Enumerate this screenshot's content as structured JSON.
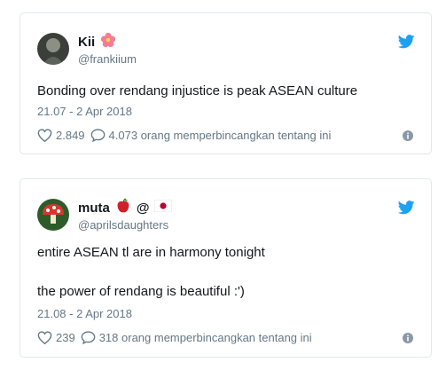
{
  "tweets": [
    {
      "name": "Kii",
      "handle": "@frankiium",
      "text_lines": [
        "Bonding over rendang injustice is peak ASEAN culture"
      ],
      "timestamp": "21.07 - 2 Apr 2018",
      "likes": "2.849",
      "replies_text": "4.073 orang memperbincangkan tentang ini"
    },
    {
      "name": "muta",
      "name_extra": "@",
      "handle": "@aprilsdaughters",
      "text_lines": [
        "entire ASEAN tl are in harmony tonight",
        "the power of rendang is beautiful :')"
      ],
      "timestamp": "21.08 - 2 Apr 2018",
      "likes": "239",
      "replies_text": "318 orang memperbincangkan tentang ini"
    }
  ],
  "icons": {
    "bird": "twitter-bird-icon",
    "heart": "heart-icon",
    "reply": "speech-bubble-icon",
    "info": "info-icon"
  },
  "colors": {
    "twitter_blue": "#1da1f2",
    "secondary_text": "#657786",
    "border": "#e1e8ed"
  }
}
